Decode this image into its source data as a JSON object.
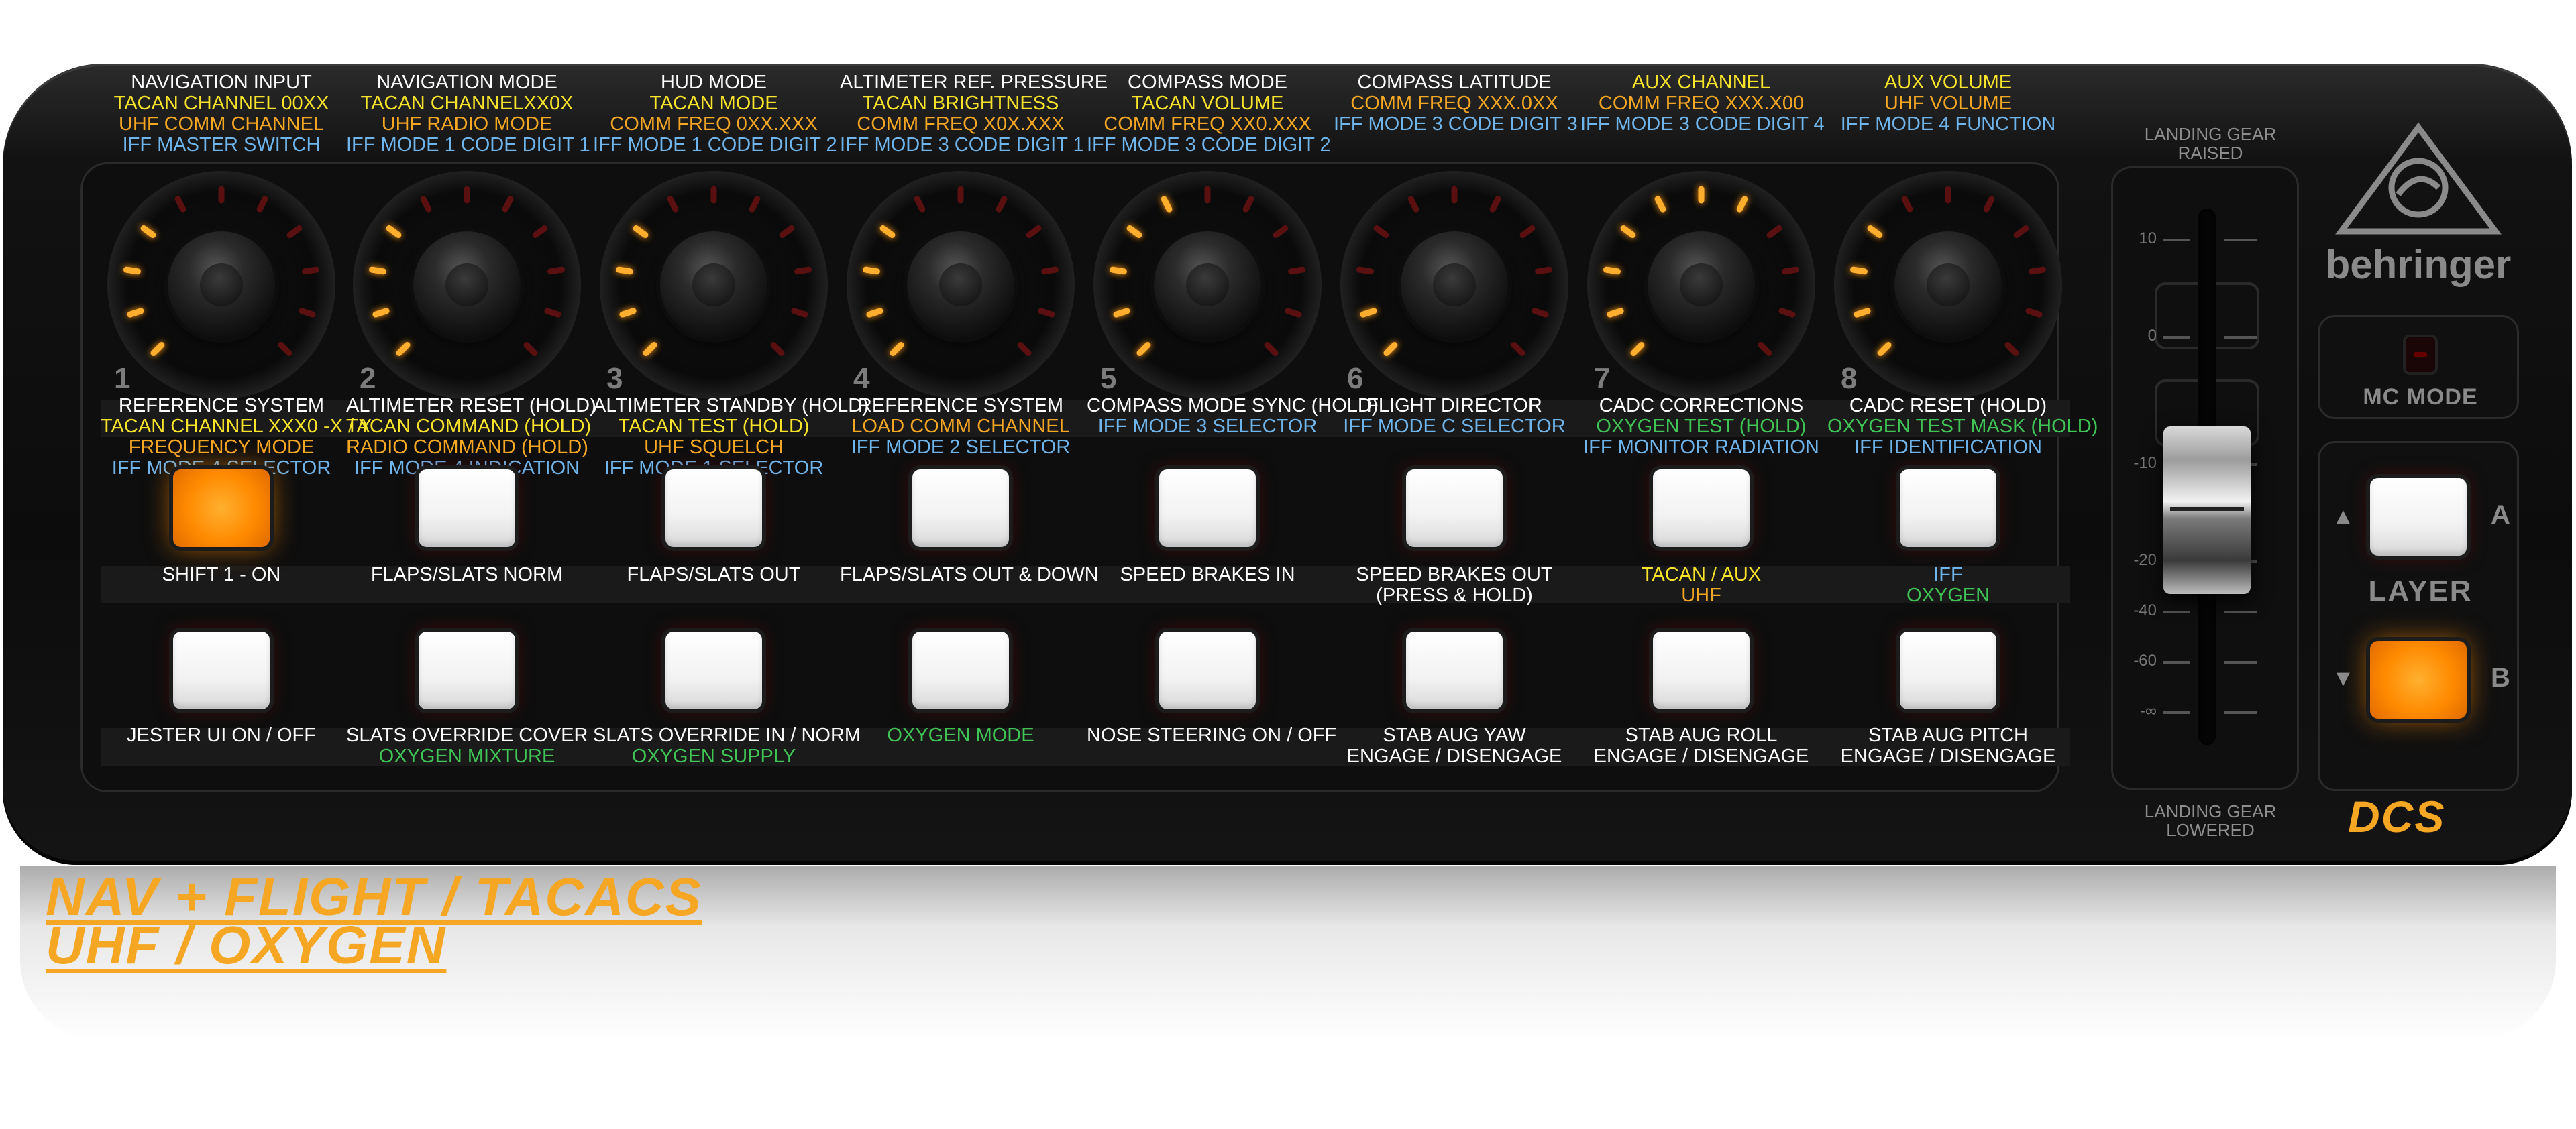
{
  "brand": "behringer",
  "mode_label": "MC MODE",
  "layer": {
    "label": "LAYER",
    "a": "A",
    "b": "B"
  },
  "dcs_logo": "DCS",
  "title": {
    "line1": "NAV + FLIGHT / TACACS",
    "line2": "UHF / OXYGEN"
  },
  "fader": {
    "top_label": "LANDING GEAR RAISED",
    "bottom_label": "LANDING GEAR LOWERED",
    "scale": [
      "10",
      "0",
      "-10",
      "-20",
      "-40",
      "-60",
      "-∞"
    ]
  },
  "colors": {
    "white": "#ffffff",
    "yellow": "#f6e32a",
    "orange": "#f5a623",
    "blue": "#6fb4ea",
    "green": "#3fc455",
    "button_lit": "#ff8a00"
  },
  "knobs": [
    {
      "number": "1",
      "lit_ticks": 4,
      "top": [
        [
          "white",
          "NAVIGATION INPUT"
        ],
        [
          "yellow",
          "TACAN CHANNEL 00XX"
        ],
        [
          "orange",
          "UHF COMM CHANNEL"
        ],
        [
          "blue",
          "IFF MASTER SWITCH"
        ]
      ],
      "push": [
        [
          "white",
          "REFERENCE SYSTEM"
        ],
        [
          "yellow",
          "TACAN CHANNEL XXX0 -X / Y"
        ],
        [
          "orange",
          "FREQUENCY MODE"
        ],
        [
          "blue",
          "IFF MODE 4 SELECTOR"
        ]
      ]
    },
    {
      "number": "2",
      "lit_ticks": 4,
      "top": [
        [
          "white",
          "NAVIGATION MODE"
        ],
        [
          "yellow",
          "TACAN CHANNELXX0X"
        ],
        [
          "orange",
          "UHF RADIO MODE"
        ],
        [
          "blue",
          "IFF MODE 1 CODE DIGIT 1"
        ]
      ],
      "push": [
        [
          "white",
          "ALTIMETER RESET (HOLD)"
        ],
        [
          "yellow",
          "TACAN COMMAND (HOLD)"
        ],
        [
          "orange",
          "RADIO COMMAND (HOLD)"
        ],
        [
          "blue",
          "IFF MODE 4 INDICATION"
        ]
      ]
    },
    {
      "number": "3",
      "lit_ticks": 4,
      "top": [
        [
          "white",
          "HUD MODE"
        ],
        [
          "yellow",
          "TACAN MODE"
        ],
        [
          "orange",
          "COMM FREQ 0XX.XXX"
        ],
        [
          "blue",
          "IFF MODE 1 CODE DIGIT 2"
        ]
      ],
      "push": [
        [
          "white",
          "ALTIMETER STANDBY (HOLD)"
        ],
        [
          "yellow",
          "TACAN TEST (HOLD)"
        ],
        [
          "orange",
          "UHF SQUELCH"
        ],
        [
          "blue",
          "IFF MODE 1 SELECTOR"
        ]
      ]
    },
    {
      "number": "4",
      "lit_ticks": 4,
      "top": [
        [
          "white",
          "ALTIMETER REF. PRESSURE"
        ],
        [
          "yellow",
          "TACAN BRIGHTNESS"
        ],
        [
          "orange",
          "COMM FREQ X0X.XXX"
        ],
        [
          "blue",
          "IFF MODE 3 CODE DIGIT 1"
        ]
      ],
      "push": [
        [
          "white",
          "REFERENCE SYSTEM"
        ],
        [
          "white",
          ""
        ],
        [
          "orange",
          "LOAD COMM CHANNEL"
        ],
        [
          "blue",
          "IFF MODE 2 SELECTOR"
        ]
      ]
    },
    {
      "number": "5",
      "lit_ticks": 5,
      "top": [
        [
          "white",
          "COMPASS MODE"
        ],
        [
          "yellow",
          "TACAN VOLUME"
        ],
        [
          "orange",
          "COMM FREQ XX0.XXX"
        ],
        [
          "blue",
          "IFF MODE 3 CODE DIGIT 2"
        ]
      ],
      "push": [
        [
          "white",
          "COMPASS MODE SYNC (HOLD)"
        ],
        [
          "white",
          ""
        ],
        [
          "white",
          ""
        ],
        [
          "blue",
          "IFF MODE 3 SELECTOR"
        ]
      ]
    },
    {
      "number": "6",
      "lit_ticks": 2,
      "top": [
        [
          "white",
          "COMPASS LATITUDE"
        ],
        [
          "white",
          ""
        ],
        [
          "orange",
          "COMM FREQ XXX.0XX"
        ],
        [
          "blue",
          "IFF MODE 3 CODE DIGIT 3"
        ]
      ],
      "push": [
        [
          "white",
          "FLIGHT DIRECTOR"
        ],
        [
          "white",
          ""
        ],
        [
          "white",
          ""
        ],
        [
          "blue",
          "IFF MODE C SELECTOR"
        ]
      ]
    },
    {
      "number": "7",
      "lit_ticks": 7,
      "top": [
        [
          "white",
          ""
        ],
        [
          "yellow",
          "AUX CHANNEL"
        ],
        [
          "orange",
          "COMM FREQ XXX.X00"
        ],
        [
          "blue",
          "IFF MODE 3 CODE DIGIT 4"
        ]
      ],
      "push": [
        [
          "white",
          "CADC CORRECTIONS"
        ],
        [
          "green",
          "OXYGEN TEST (HOLD)"
        ],
        [
          "white",
          ""
        ],
        [
          "blue",
          "IFF MONITOR RADIATION"
        ]
      ]
    },
    {
      "number": "8",
      "lit_ticks": 4,
      "top": [
        [
          "white",
          ""
        ],
        [
          "yellow",
          "AUX VOLUME"
        ],
        [
          "orange",
          "UHF VOLUME"
        ],
        [
          "blue",
          "IFF MODE 4 FUNCTION"
        ]
      ],
      "push": [
        [
          "white",
          "CADC RESET (HOLD)"
        ],
        [
          "green",
          "OXYGEN TEST MASK (HOLD)"
        ],
        [
          "white",
          ""
        ],
        [
          "blue",
          "IFF IDENTIFICATION"
        ]
      ]
    }
  ],
  "row1_buttons": [
    {
      "lit": true,
      "labels": [
        [
          "white",
          "SHIFT 1 - ON"
        ],
        [
          "white",
          ""
        ]
      ]
    },
    {
      "lit": false,
      "labels": [
        [
          "white",
          "FLAPS/SLATS NORM"
        ],
        [
          "white",
          ""
        ]
      ]
    },
    {
      "lit": false,
      "labels": [
        [
          "white",
          "FLAPS/SLATS OUT"
        ],
        [
          "white",
          ""
        ]
      ]
    },
    {
      "lit": false,
      "labels": [
        [
          "white",
          "FLAPS/SLATS OUT & DOWN"
        ],
        [
          "white",
          ""
        ]
      ]
    },
    {
      "lit": false,
      "labels": [
        [
          "white",
          "SPEED BRAKES IN"
        ],
        [
          "white",
          ""
        ]
      ]
    },
    {
      "lit": false,
      "labels": [
        [
          "white",
          "SPEED BRAKES OUT"
        ],
        [
          "white",
          "(PRESS & HOLD)"
        ]
      ]
    },
    {
      "lit": false,
      "labels": [
        [
          "yellow",
          "TACAN / AUX"
        ],
        [
          "orange",
          "UHF"
        ]
      ]
    },
    {
      "lit": false,
      "labels": [
        [
          "blue",
          "IFF"
        ],
        [
          "green",
          "OXYGEN"
        ]
      ]
    }
  ],
  "row2_buttons": [
    {
      "lit": false,
      "labels": [
        [
          "white",
          "JESTER UI ON / OFF"
        ],
        [
          "white",
          ""
        ]
      ]
    },
    {
      "lit": false,
      "labels": [
        [
          "white",
          "SLATS OVERRIDE COVER"
        ],
        [
          "green",
          "OXYGEN MIXTURE"
        ]
      ]
    },
    {
      "lit": false,
      "labels": [
        [
          "white",
          "SLATS OVERRIDE IN / NORM"
        ],
        [
          "green",
          "OXYGEN SUPPLY"
        ]
      ]
    },
    {
      "lit": false,
      "labels": [
        [
          "white",
          ""
        ],
        [
          "green",
          "OXYGEN MODE"
        ]
      ]
    },
    {
      "lit": false,
      "labels": [
        [
          "white",
          "NOSE STEERING ON / OFF"
        ],
        [
          "white",
          ""
        ]
      ]
    },
    {
      "lit": false,
      "labels": [
        [
          "white",
          "STAB AUG YAW"
        ],
        [
          "white",
          "ENGAGE / DISENGAGE"
        ]
      ]
    },
    {
      "lit": false,
      "labels": [
        [
          "white",
          "STAB AUG ROLL"
        ],
        [
          "white",
          "ENGAGE / DISENGAGE"
        ]
      ]
    },
    {
      "lit": false,
      "labels": [
        [
          "white",
          "STAB AUG PITCH"
        ],
        [
          "white",
          "ENGAGE / DISENGAGE"
        ]
      ]
    }
  ]
}
